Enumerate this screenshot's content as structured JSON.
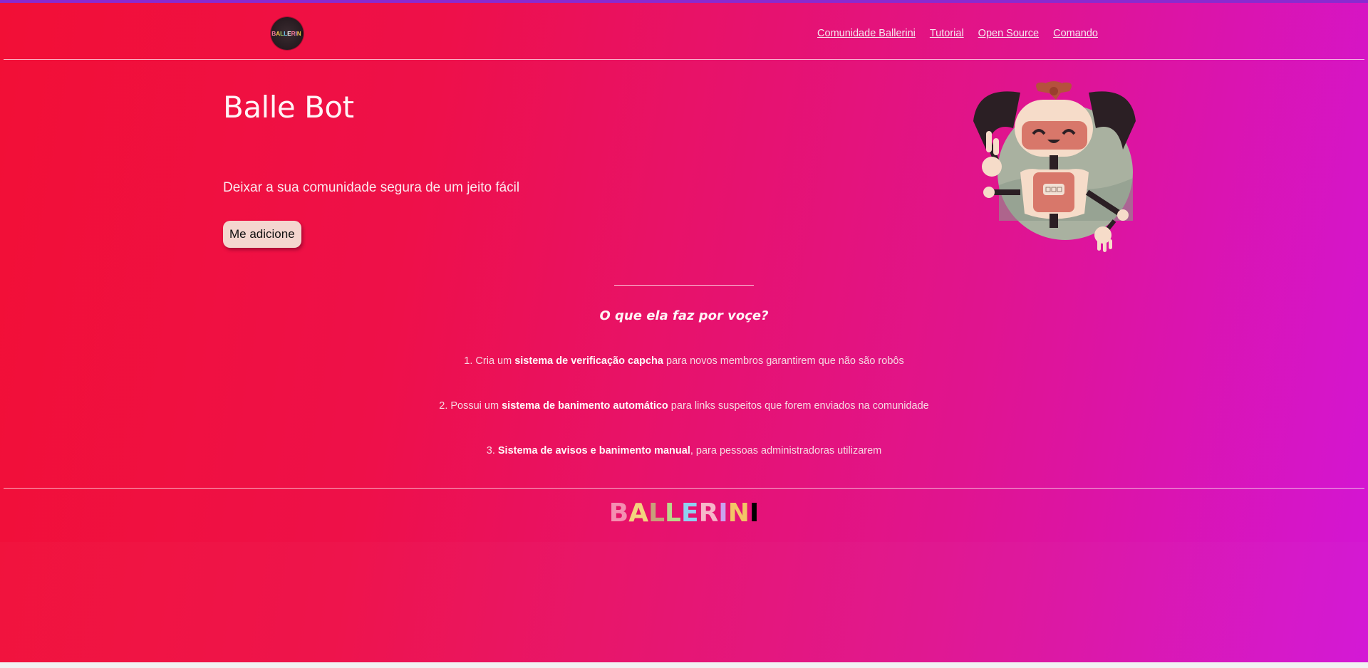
{
  "header": {
    "logo_letters": [
      "B",
      "A",
      "L",
      "L",
      "E",
      "R",
      "I",
      "N",
      "I"
    ],
    "nav": [
      {
        "label": "Comunidade Ballerini"
      },
      {
        "label": "Tutorial"
      },
      {
        "label": "Open Source"
      },
      {
        "label": "Comando"
      }
    ]
  },
  "hero": {
    "title": "Balle Bot",
    "subtitle": "Deixar a sua comunidade segura de um jeito fácil",
    "button_label": "Me adicione"
  },
  "features": {
    "title": "O que ela faz por voçe?",
    "items": [
      {
        "prefix": "1. Cria um ",
        "bold": "sistema de verificação capcha",
        "suffix": " para novos membros garantirem que não são robôs"
      },
      {
        "prefix": "2. Possui um ",
        "bold": "sistema de banimento automático",
        "suffix": " para links suspeitos que forem enviados na comunidade"
      },
      {
        "prefix": "3. ",
        "bold": "Sistema de avisos e banimento manual",
        "suffix": ", para pessoas administradoras utilizarem"
      }
    ]
  },
  "footer": {
    "logo_letters": [
      "B",
      "A",
      "L",
      "L",
      "E",
      "R",
      "I",
      "N",
      "I"
    ]
  },
  "colors": {
    "gradient_start": "#f20f36",
    "gradient_end": "#d315d6",
    "button_bg": "#f4d6cf"
  }
}
